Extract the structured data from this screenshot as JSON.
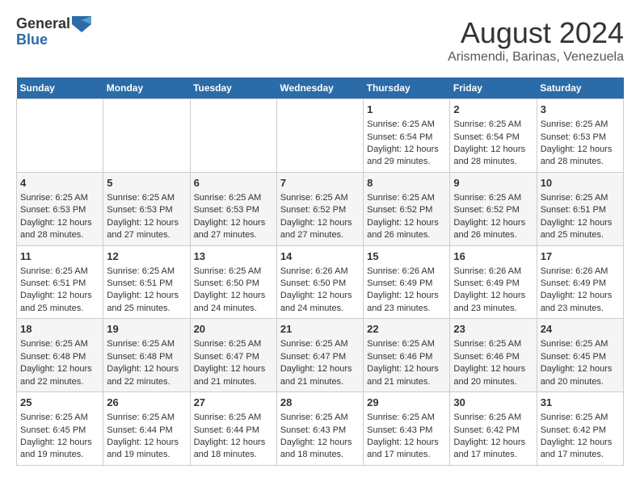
{
  "header": {
    "logo_line1": "General",
    "logo_line2": "Blue",
    "main_title": "August 2024",
    "subtitle": "Arismendi, Barinas, Venezuela"
  },
  "calendar": {
    "days_of_week": [
      "Sunday",
      "Monday",
      "Tuesday",
      "Wednesday",
      "Thursday",
      "Friday",
      "Saturday"
    ],
    "weeks": [
      [
        {
          "day": "",
          "content": ""
        },
        {
          "day": "",
          "content": ""
        },
        {
          "day": "",
          "content": ""
        },
        {
          "day": "",
          "content": ""
        },
        {
          "day": "1",
          "content": "Sunrise: 6:25 AM\nSunset: 6:54 PM\nDaylight: 12 hours and 29 minutes."
        },
        {
          "day": "2",
          "content": "Sunrise: 6:25 AM\nSunset: 6:54 PM\nDaylight: 12 hours and 28 minutes."
        },
        {
          "day": "3",
          "content": "Sunrise: 6:25 AM\nSunset: 6:53 PM\nDaylight: 12 hours and 28 minutes."
        }
      ],
      [
        {
          "day": "4",
          "content": "Sunrise: 6:25 AM\nSunset: 6:53 PM\nDaylight: 12 hours and 28 minutes."
        },
        {
          "day": "5",
          "content": "Sunrise: 6:25 AM\nSunset: 6:53 PM\nDaylight: 12 hours and 27 minutes."
        },
        {
          "day": "6",
          "content": "Sunrise: 6:25 AM\nSunset: 6:53 PM\nDaylight: 12 hours and 27 minutes."
        },
        {
          "day": "7",
          "content": "Sunrise: 6:25 AM\nSunset: 6:52 PM\nDaylight: 12 hours and 27 minutes."
        },
        {
          "day": "8",
          "content": "Sunrise: 6:25 AM\nSunset: 6:52 PM\nDaylight: 12 hours and 26 minutes."
        },
        {
          "day": "9",
          "content": "Sunrise: 6:25 AM\nSunset: 6:52 PM\nDaylight: 12 hours and 26 minutes."
        },
        {
          "day": "10",
          "content": "Sunrise: 6:25 AM\nSunset: 6:51 PM\nDaylight: 12 hours and 25 minutes."
        }
      ],
      [
        {
          "day": "11",
          "content": "Sunrise: 6:25 AM\nSunset: 6:51 PM\nDaylight: 12 hours and 25 minutes."
        },
        {
          "day": "12",
          "content": "Sunrise: 6:25 AM\nSunset: 6:51 PM\nDaylight: 12 hours and 25 minutes."
        },
        {
          "day": "13",
          "content": "Sunrise: 6:25 AM\nSunset: 6:50 PM\nDaylight: 12 hours and 24 minutes."
        },
        {
          "day": "14",
          "content": "Sunrise: 6:26 AM\nSunset: 6:50 PM\nDaylight: 12 hours and 24 minutes."
        },
        {
          "day": "15",
          "content": "Sunrise: 6:26 AM\nSunset: 6:49 PM\nDaylight: 12 hours and 23 minutes."
        },
        {
          "day": "16",
          "content": "Sunrise: 6:26 AM\nSunset: 6:49 PM\nDaylight: 12 hours and 23 minutes."
        },
        {
          "day": "17",
          "content": "Sunrise: 6:26 AM\nSunset: 6:49 PM\nDaylight: 12 hours and 23 minutes."
        }
      ],
      [
        {
          "day": "18",
          "content": "Sunrise: 6:25 AM\nSunset: 6:48 PM\nDaylight: 12 hours and 22 minutes."
        },
        {
          "day": "19",
          "content": "Sunrise: 6:25 AM\nSunset: 6:48 PM\nDaylight: 12 hours and 22 minutes."
        },
        {
          "day": "20",
          "content": "Sunrise: 6:25 AM\nSunset: 6:47 PM\nDaylight: 12 hours and 21 minutes."
        },
        {
          "day": "21",
          "content": "Sunrise: 6:25 AM\nSunset: 6:47 PM\nDaylight: 12 hours and 21 minutes."
        },
        {
          "day": "22",
          "content": "Sunrise: 6:25 AM\nSunset: 6:46 PM\nDaylight: 12 hours and 21 minutes."
        },
        {
          "day": "23",
          "content": "Sunrise: 6:25 AM\nSunset: 6:46 PM\nDaylight: 12 hours and 20 minutes."
        },
        {
          "day": "24",
          "content": "Sunrise: 6:25 AM\nSunset: 6:45 PM\nDaylight: 12 hours and 20 minutes."
        }
      ],
      [
        {
          "day": "25",
          "content": "Sunrise: 6:25 AM\nSunset: 6:45 PM\nDaylight: 12 hours and 19 minutes."
        },
        {
          "day": "26",
          "content": "Sunrise: 6:25 AM\nSunset: 6:44 PM\nDaylight: 12 hours and 19 minutes."
        },
        {
          "day": "27",
          "content": "Sunrise: 6:25 AM\nSunset: 6:44 PM\nDaylight: 12 hours and 18 minutes."
        },
        {
          "day": "28",
          "content": "Sunrise: 6:25 AM\nSunset: 6:43 PM\nDaylight: 12 hours and 18 minutes."
        },
        {
          "day": "29",
          "content": "Sunrise: 6:25 AM\nSunset: 6:43 PM\nDaylight: 12 hours and 17 minutes."
        },
        {
          "day": "30",
          "content": "Sunrise: 6:25 AM\nSunset: 6:42 PM\nDaylight: 12 hours and 17 minutes."
        },
        {
          "day": "31",
          "content": "Sunrise: 6:25 AM\nSunset: 6:42 PM\nDaylight: 12 hours and 17 minutes."
        }
      ]
    ]
  }
}
